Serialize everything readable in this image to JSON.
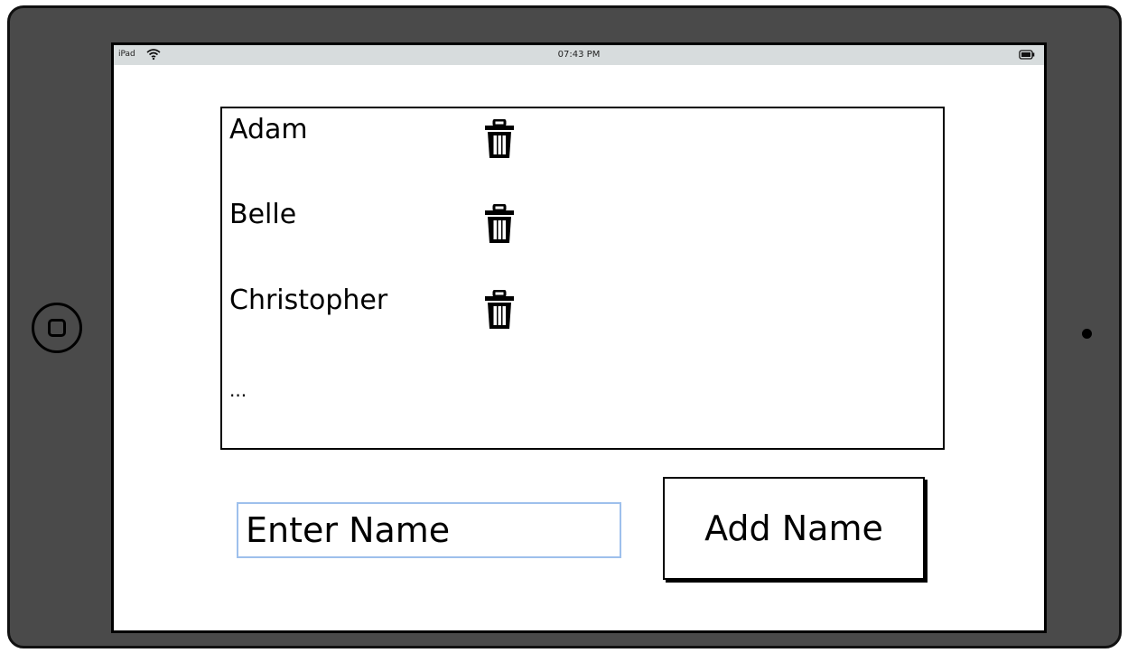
{
  "statusbar": {
    "device": "iPad",
    "time": "07:43 PM"
  },
  "list": {
    "items": [
      {
        "name": "Adam",
        "delete_icon": "trash-icon"
      },
      {
        "name": "Belle",
        "delete_icon": "trash-icon"
      },
      {
        "name": "Christopher",
        "delete_icon": "trash-icon"
      }
    ],
    "more": "..."
  },
  "form": {
    "placeholder": "Enter Name",
    "value": "",
    "add_label": "Add Name"
  },
  "colors": {
    "device_frame": "#4a4a4a",
    "statusbar": "#d7dcdd",
    "input_border": "#9ec0ec"
  }
}
